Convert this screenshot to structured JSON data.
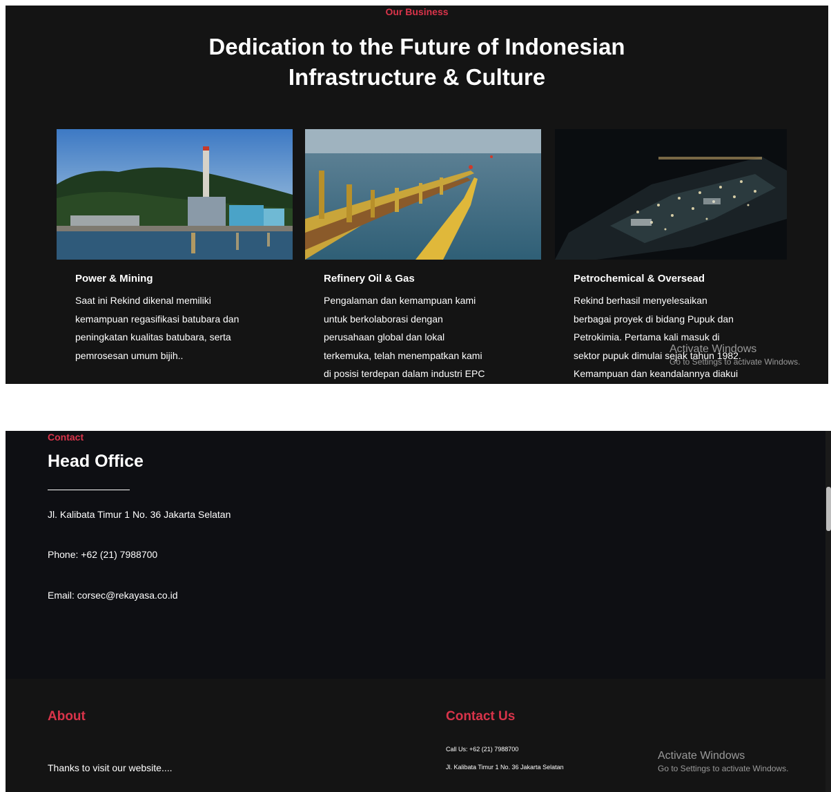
{
  "business": {
    "eyebrow": "Our Business",
    "title_line1": "Dedication to the Future of Indonesian",
    "title_line2": "Infrastructure & Culture",
    "cards": [
      {
        "title": "Power & Mining",
        "lines": [
          "Saat ini Rekind dikenal memiliki",
          "kemampuan regasifikasi batubara dan",
          "peningkatan kualitas batubara, serta",
          "pemrosesan umum bijih.."
        ]
      },
      {
        "title": "Refinery Oil & Gas",
        "lines": [
          "Pengalaman dan kemampuan kami",
          "untuk berkolaborasi dengan",
          "perusahaan global dan lokal",
          "terkemuka, telah menempatkan kami",
          "di posisi terdepan dalam industri EPC"
        ]
      },
      {
        "title": "Petrochemical & Oversead",
        "lines": [
          "Rekind berhasil menyelesaikan",
          "berbagai proyek di bidang Pupuk dan",
          "Petrokimia. Pertama kali masuk di",
          "sektor pupuk dimulai sejak tahun 1982.",
          "Kemampuan dan keandalannya diakui"
        ]
      }
    ]
  },
  "windows_watermark": {
    "line1": "Activate Windows",
    "line2": "Go to Settings to activate Windows."
  },
  "contact": {
    "eyebrow": "Contact",
    "title": "Head Office",
    "address": "Jl. Kalibata Timur 1 No. 36 Jakarta Selatan",
    "phone": "Phone: +62 (21) 7988700",
    "email": "Email: corsec@rekayasa.co.id"
  },
  "footer": {
    "about_title": "About",
    "about_text": "Thanks to visit our website....",
    "contact_title": "Contact Us",
    "call": "Call Us: +62 (21) 7988700",
    "address": "Jl. Kalibata Timur 1 No. 36 Jakarta Selatan"
  },
  "colors": {
    "accent": "#d9344a",
    "section_bg": "#141414",
    "contact_bg": "#0e0f13"
  }
}
